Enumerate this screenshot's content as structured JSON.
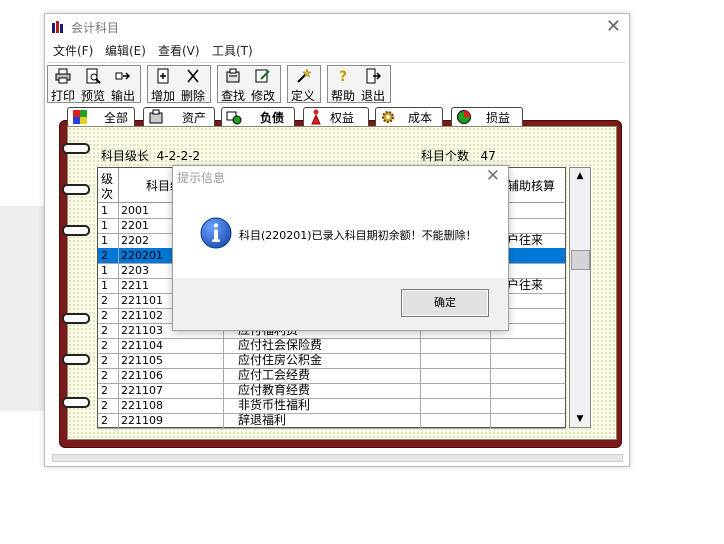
{
  "window": {
    "title": "会计科目"
  },
  "menu": [
    "文件(F)",
    "编辑(E)",
    "查看(V)",
    "工具(T)"
  ],
  "toolbar": {
    "print": "打印",
    "preview": "预览",
    "export": "输出",
    "add": "增加",
    "delete": "删除",
    "find": "查找",
    "modify": "修改",
    "define": "定义",
    "help": "帮助",
    "exit": "退出"
  },
  "tabs": [
    "全部",
    "资产",
    "负债",
    "权益",
    "成本",
    "损益"
  ],
  "active_tab": "负债",
  "info": {
    "level_label": "科目级长",
    "level_value": "4-2-2-2",
    "count_label": "科目个数",
    "count_value": "47"
  },
  "table": {
    "headers": {
      "level_top": "级",
      "level_bottom": "次",
      "code": "科目编",
      "aux": "辅助核算"
    },
    "rows": [
      {
        "level": "1",
        "code": "2001",
        "name": "",
        "aux": ""
      },
      {
        "level": "1",
        "code": "2201",
        "name": "",
        "aux": ""
      },
      {
        "level": "1",
        "code": "2202",
        "name": "",
        "aux": "户往来"
      },
      {
        "level": "2",
        "code": "220201",
        "name": "",
        "aux": ""
      },
      {
        "level": "1",
        "code": "2203",
        "name": "",
        "aux": ""
      },
      {
        "level": "1",
        "code": "2211",
        "name": "",
        "aux": "户往来"
      },
      {
        "level": "2",
        "code": "221101",
        "name": "",
        "aux": ""
      },
      {
        "level": "2",
        "code": "221102",
        "name": "",
        "aux": ""
      },
      {
        "level": "2",
        "code": "221103",
        "name": "应付福利费",
        "aux": ""
      },
      {
        "level": "2",
        "code": "221104",
        "name": "应付社会保险费",
        "aux": ""
      },
      {
        "level": "2",
        "code": "221105",
        "name": "应付住房公积金",
        "aux": ""
      },
      {
        "level": "2",
        "code": "221106",
        "name": "应付工会经费",
        "aux": ""
      },
      {
        "level": "2",
        "code": "221107",
        "name": "应付教育经费",
        "aux": ""
      },
      {
        "level": "2",
        "code": "221108",
        "name": "非货币性福利",
        "aux": ""
      },
      {
        "level": "2",
        "code": "221109",
        "name": "辞退福利",
        "aux": ""
      }
    ],
    "selected_row": 3
  },
  "dialog": {
    "title": "提示信息",
    "message": "科目(220201)已录入科目期初余额！不能删除！",
    "ok": "确定"
  },
  "colors": {
    "binder": "#7a1a1a",
    "selection": "#0078d7",
    "info_icon": "#1f5fbf"
  }
}
